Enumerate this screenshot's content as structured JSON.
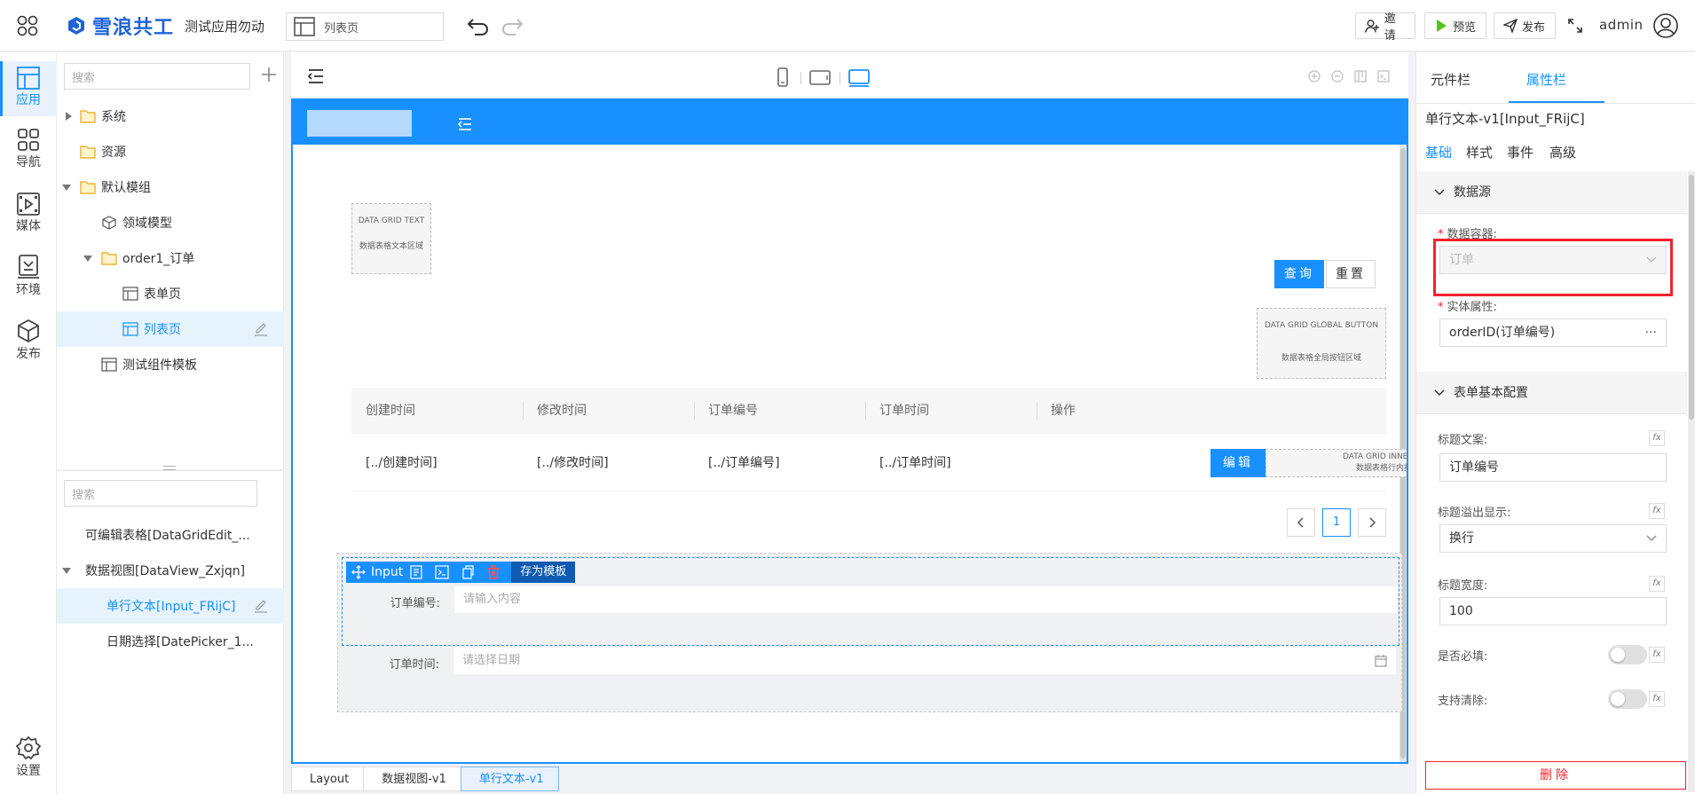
{
  "topbar": {
    "brand": "雪浪共工",
    "app_name": "测试应用勿动",
    "page_selector": "列表页",
    "invite": "邀请",
    "preview": "预览",
    "publish": "发布",
    "user": "admin"
  },
  "rail": {
    "items": [
      {
        "label": "应用",
        "icon": "app-layout-icon",
        "active": true
      },
      {
        "label": "导航",
        "icon": "grid-nav-icon"
      },
      {
        "label": "媒体",
        "icon": "media-icon"
      },
      {
        "label": "环境",
        "icon": "environment-icon"
      },
      {
        "label": "发布",
        "icon": "cube-publish-icon"
      }
    ],
    "settings": "设置"
  },
  "tree": {
    "search_placeholder": "搜索",
    "nodes": [
      {
        "label": "系统",
        "icon": "folder-icon"
      },
      {
        "label": "资源",
        "icon": "folder-icon"
      },
      {
        "label": "默认模组",
        "icon": "folder-icon"
      },
      {
        "label": "领域模型",
        "icon": "cube-icon"
      },
      {
        "label": "order1_订单",
        "icon": "folder-open-icon"
      },
      {
        "label": "表单页",
        "icon": "page-icon"
      },
      {
        "label": "列表页",
        "icon": "page-icon",
        "selected": true
      },
      {
        "label": "测试组件模板",
        "icon": "page-icon"
      }
    ]
  },
  "components": {
    "search_placeholder": "搜索",
    "items": [
      {
        "label": "可编辑表格[DataGridEdit_..."
      },
      {
        "label": "数据视图[DataView_Zxjqn]"
      },
      {
        "label": "单行文本[Input_FRijC]",
        "selected": true
      },
      {
        "label": "日期选择[DatePicker_1..."
      }
    ]
  },
  "canvas": {
    "dg_text": {
      "en": "DATA GRID TEXT",
      "zh": "数据表格文本区域"
    },
    "query": "查询",
    "reset": "重置",
    "dg_global": {
      "en": "DATA GRID GLOBAL BUTTON",
      "zh": "数据表格全局按钮区域"
    },
    "columns": [
      "创建时间",
      "修改时间",
      "订单编号",
      "订单时间",
      "操作"
    ],
    "row": [
      "[../创建时间]",
      "[../修改时间]",
      "[../订单编号]",
      "[../订单时间]"
    ],
    "edit": "编辑",
    "dg_inner": {
      "en": "DATA GRID INNER BUTTON",
      "zh": "数据表格行内按钮区域"
    },
    "page": "1",
    "input_toolbar": {
      "name": "Input",
      "save_template": "存为模板"
    },
    "field1": {
      "label": "订单编号:",
      "placeholder": "请输入内容"
    },
    "field2": {
      "label": "订单时间:",
      "placeholder": "请选择日期"
    }
  },
  "breadcrumbs": [
    "Layout",
    "数据视图-v1",
    "单行文本-v1"
  ],
  "props": {
    "tabs": [
      "元件栏",
      "属性栏"
    ],
    "component_title": "单行文本-v1[Input_FRijC]",
    "subtabs": [
      "基础",
      "样式",
      "事件",
      "高级"
    ],
    "section_datasource": "数据源",
    "data_container_label": "数据容器:",
    "data_container_value": "订单",
    "entity_attr_label": "实体属性:",
    "entity_attr_value": "orderID(订单编号)",
    "more": "···",
    "section_form": "表单基本配置",
    "title_text_label": "标题文案:",
    "title_text_value": "订单编号",
    "overflow_label": "标题溢出显示:",
    "overflow_value": "换行",
    "title_width_label": "标题宽度:",
    "title_width_value": "100",
    "required_label": "是否必填:",
    "clearable_label": "支持清除:",
    "fx": "fx",
    "delete": "删除"
  },
  "colors": {
    "accent": "#1890ff",
    "danger": "#f5222d",
    "brand": "#1e64d6"
  }
}
